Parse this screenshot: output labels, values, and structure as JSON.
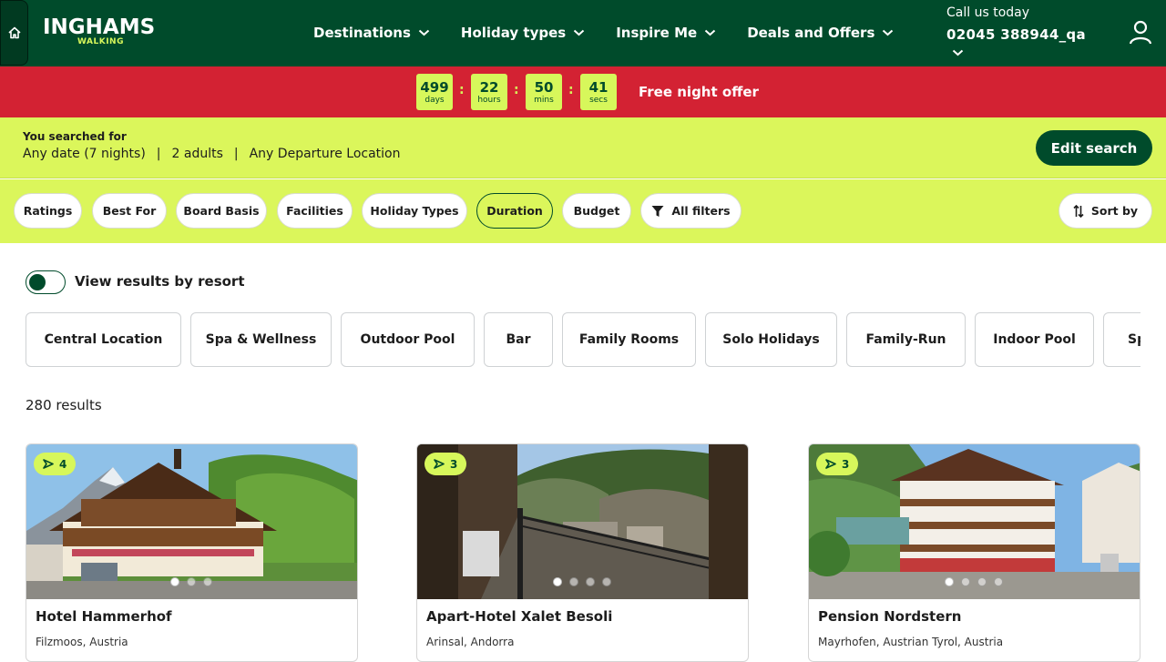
{
  "header": {
    "logo_brand": "INGHAMS",
    "logo_sub": "WALKING",
    "nav": [
      {
        "label": "Destinations"
      },
      {
        "label": "Holiday types"
      },
      {
        "label": "Inspire Me"
      },
      {
        "label": "Deals and Offers"
      }
    ],
    "call_label": "Call us today",
    "phone": "02045 388944_qa",
    "icons": [
      "home-icon",
      "chevron-down-icon",
      "user-icon"
    ]
  },
  "countdown": {
    "days": "499",
    "days_unit": "days",
    "hours": "22",
    "hours_unit": "hours",
    "mins": "50",
    "mins_unit": "mins",
    "secs": "41",
    "secs_unit": "secs",
    "separator": ":",
    "offer": "Free night offer"
  },
  "search": {
    "title": "You searched for",
    "date": "Any date (7 nights)",
    "separator": "|",
    "guests": "2 adults",
    "departure": "Any Departure Location",
    "edit_label": "Edit search"
  },
  "filters": {
    "chips": [
      "Ratings",
      "Best For",
      "Board Basis",
      "Facilities",
      "Holiday Types",
      "Duration",
      "Budget"
    ],
    "active": "Duration",
    "all_filters": "All filters",
    "sort_by": "Sort by"
  },
  "toggle": {
    "label": "View results by resort",
    "on": true
  },
  "facilities": [
    "Central Location",
    "Spa & Wellness",
    "Outdoor Pool",
    "Bar",
    "Family Rooms",
    "Solo Holidays",
    "Family-Run",
    "Indoor Pool",
    "Sp"
  ],
  "results_count": "280 results",
  "cards": [
    {
      "name": "Hotel Hammerhof",
      "location": "Filzmoos, Austria",
      "badge": "4",
      "dots": 3,
      "active_dot": 0
    },
    {
      "name": "Apart-Hotel Xalet Besoli",
      "location": "Arinsal, Andorra",
      "badge": "3",
      "dots": 4,
      "active_dot": 0
    },
    {
      "name": "Pension Nordstern",
      "location": "Mayrhofen, Austrian Tyrol, Austria",
      "badge": "3",
      "dots": 4,
      "active_dot": 0
    }
  ],
  "colors": {
    "brand_green": "#004b2b",
    "lime": "#dbf65b",
    "banner_red": "#d32233"
  }
}
